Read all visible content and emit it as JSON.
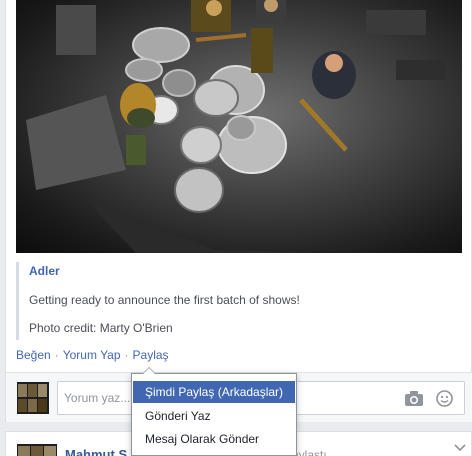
{
  "post": {
    "quote_title": "Adler",
    "quote_text": "Getting ready to announce the first batch of shows!",
    "photo_credit": "Photo credit: Marty O'Brien"
  },
  "actions": {
    "like": "Beğen",
    "comment": "Yorum Yap",
    "share": "Paylaş",
    "separator": "·"
  },
  "comment_box": {
    "placeholder": "Yorum yaz..."
  },
  "share_menu": {
    "items": [
      "Şimdi Paylaş (Arkadaşlar)",
      "Gönderi Yaz",
      "Mesaj Olarak Gönder"
    ]
  },
  "next_post": {
    "author": "Mahmut S",
    "action": "aylaştı"
  },
  "colors": {
    "link": "#4267b2",
    "menu_highlight": "#4267b2"
  },
  "icons": [
    "camera-icon",
    "smile-icon",
    "chevron-down-icon"
  ]
}
